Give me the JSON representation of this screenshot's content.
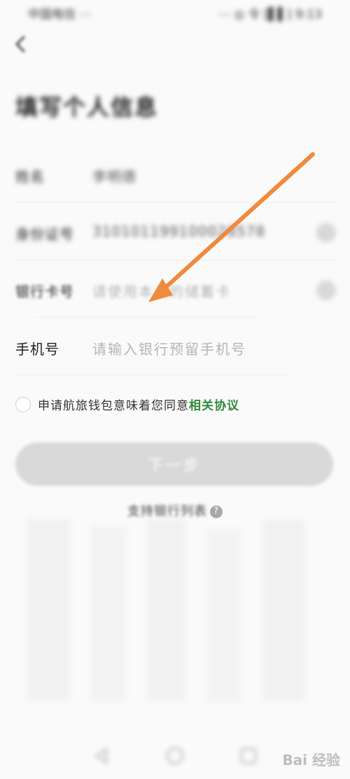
{
  "status_bar": {
    "left": "中国电信 ⋯",
    "right": "⋯ ◎ 令 ⁅▌▌⁆ 9:13"
  },
  "page": {
    "title": "填写个人信息"
  },
  "form": {
    "name": {
      "label": "姓名",
      "value": "李明德"
    },
    "id_number": {
      "label": "身份证号",
      "value": "310101199100028578"
    },
    "bank_card": {
      "label": "银行卡号",
      "placeholder": "请使用本人的储蓄卡"
    },
    "phone": {
      "label": "手机号",
      "placeholder": "请输入银行预留手机号"
    }
  },
  "agreement": {
    "text": "申请航旅钱包意味着您同意",
    "link": "相关协议"
  },
  "next_button": {
    "label": "下一步"
  },
  "support_link": {
    "label": "支持银行列表",
    "help_icon": "?"
  },
  "watermark": {
    "text": "Bai 经验"
  },
  "annotation": {
    "arrow_color": "#f08a3c"
  },
  "colors": {
    "accent_green": "#2f8a3a",
    "button_disabled": "#d9d9d9"
  }
}
